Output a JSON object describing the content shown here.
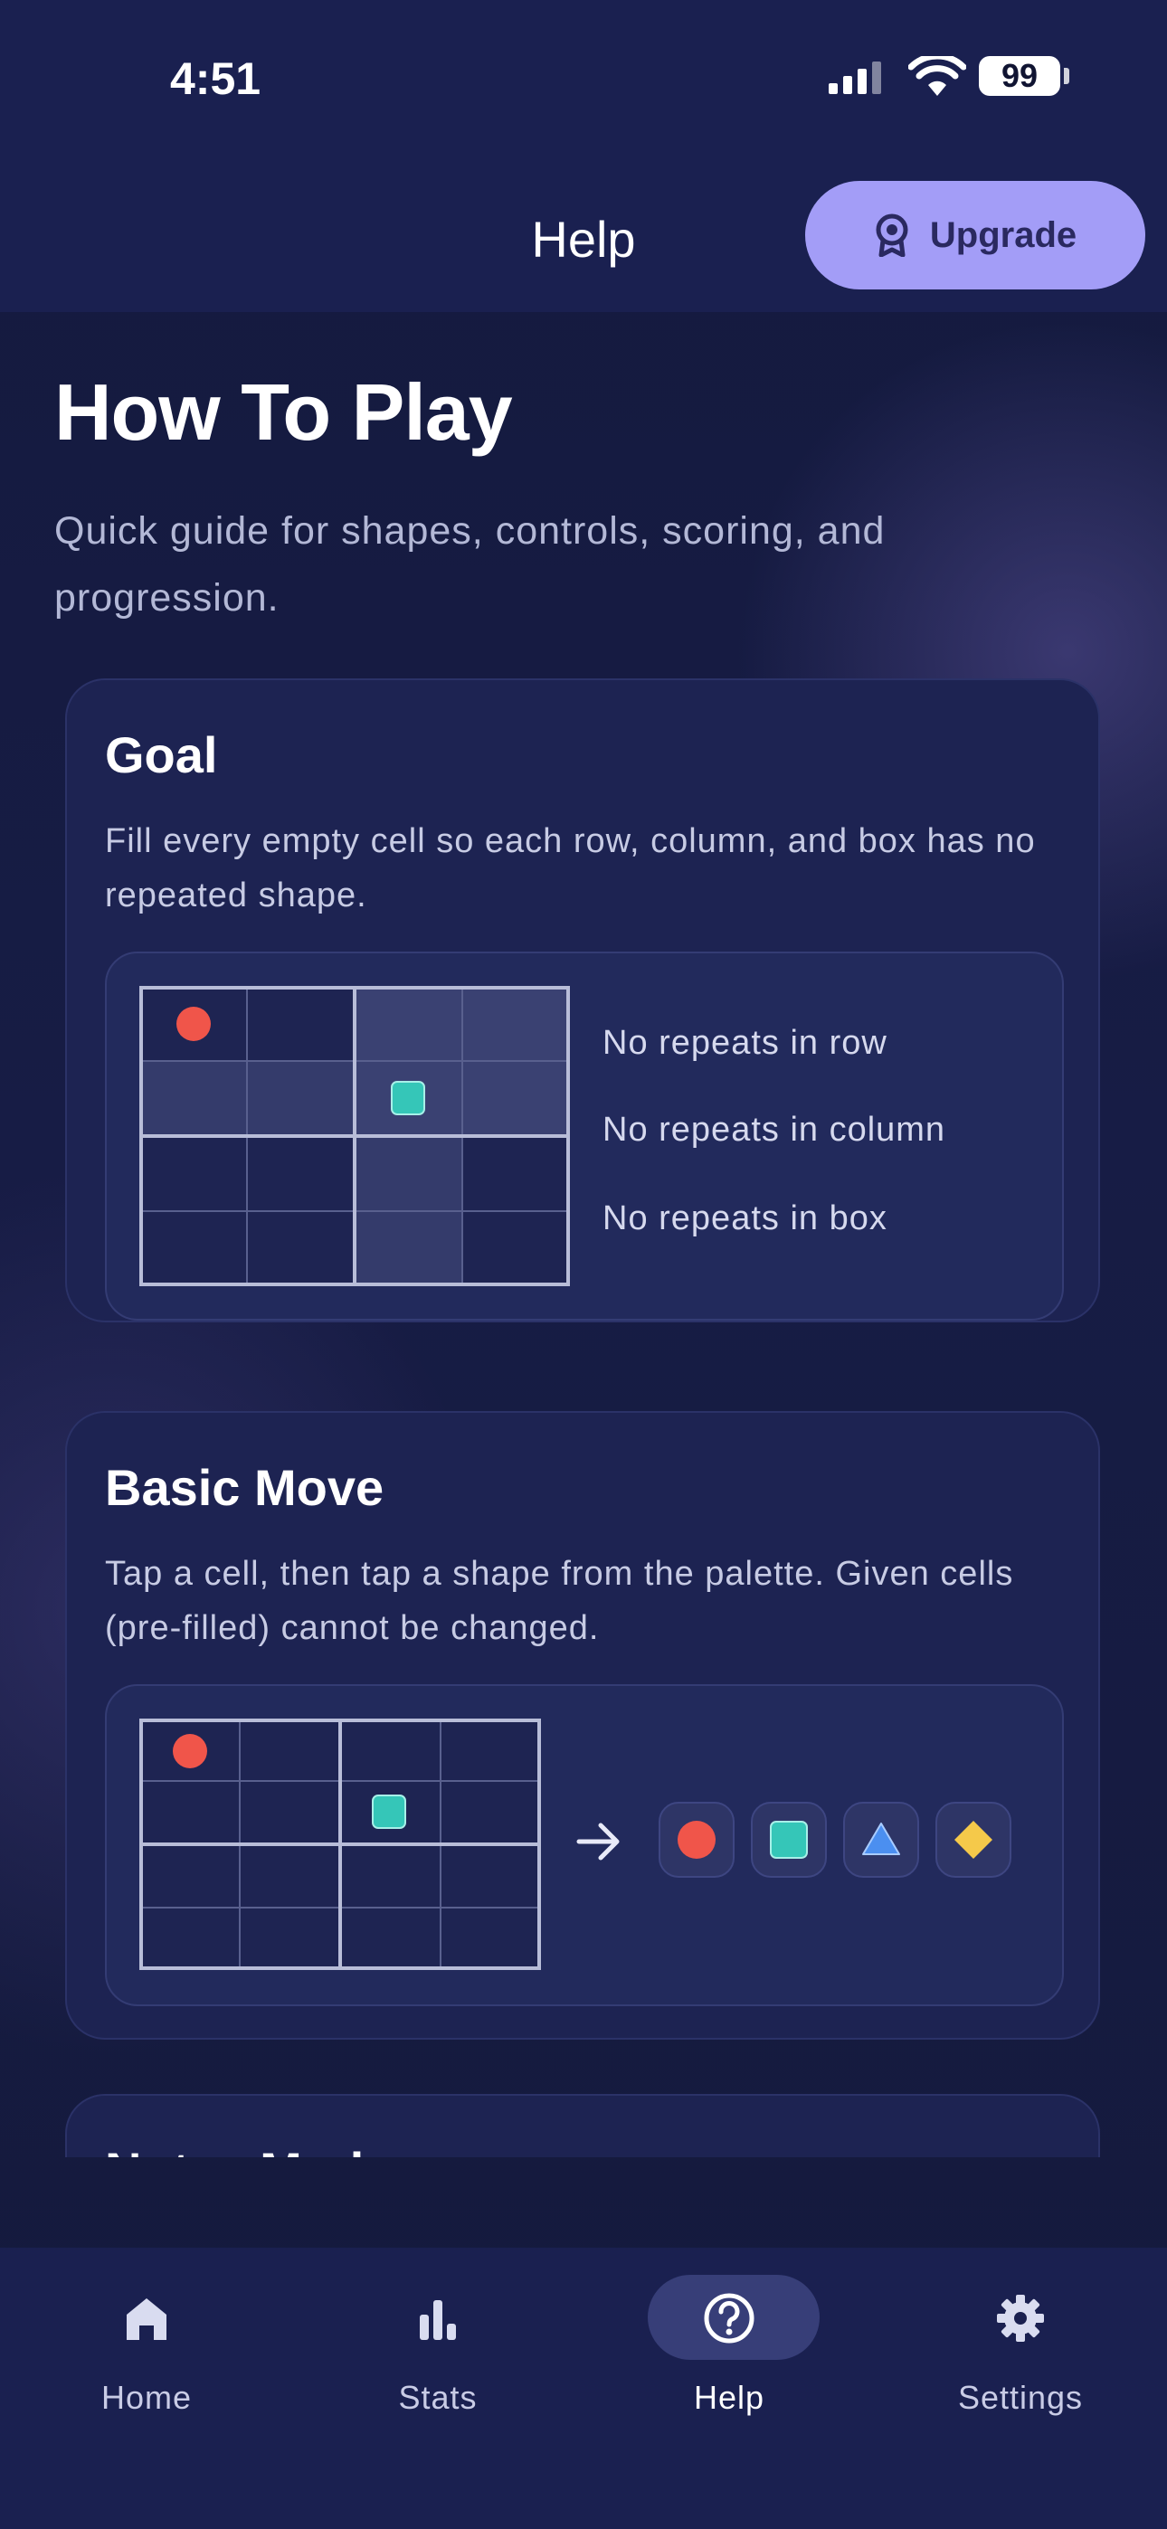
{
  "status_bar": {
    "time": "4:51",
    "battery": "99"
  },
  "header": {
    "title": "Help",
    "upgrade_label": "Upgrade"
  },
  "intro": {
    "title": "How To Play",
    "subtitle": "Quick guide for shapes, controls, scoring, and progression."
  },
  "goal_card": {
    "title": "Goal",
    "description": "Fill every empty cell so each row, column, and box has no repeated shape.",
    "rules": [
      "No repeats in row",
      "No repeats in column",
      "No repeats in box"
    ]
  },
  "move_card": {
    "title": "Basic Move",
    "description": "Tap a cell, then tap a shape from the palette. Given cells (pre-filled) cannot be changed.",
    "palette": [
      "red-circle-icon",
      "teal-square-icon",
      "blue-triangle-icon",
      "yellow-diamond-icon"
    ]
  },
  "next_card": {
    "title": "Notes Mode"
  },
  "nav": {
    "items": [
      {
        "label": "Home",
        "icon": "home-icon"
      },
      {
        "label": "Stats",
        "icon": "stats-icon"
      },
      {
        "label": "Help",
        "icon": "help-icon",
        "active": true
      },
      {
        "label": "Settings",
        "icon": "gear-icon"
      }
    ]
  },
  "colors": {
    "background": "#171c45",
    "card": "#1d2352",
    "accent": "#a39df7",
    "shape_red": "#f0554a",
    "shape_teal": "#35c6b8",
    "shape_blue": "#4b8ff0",
    "shape_yellow": "#f5c94a"
  }
}
